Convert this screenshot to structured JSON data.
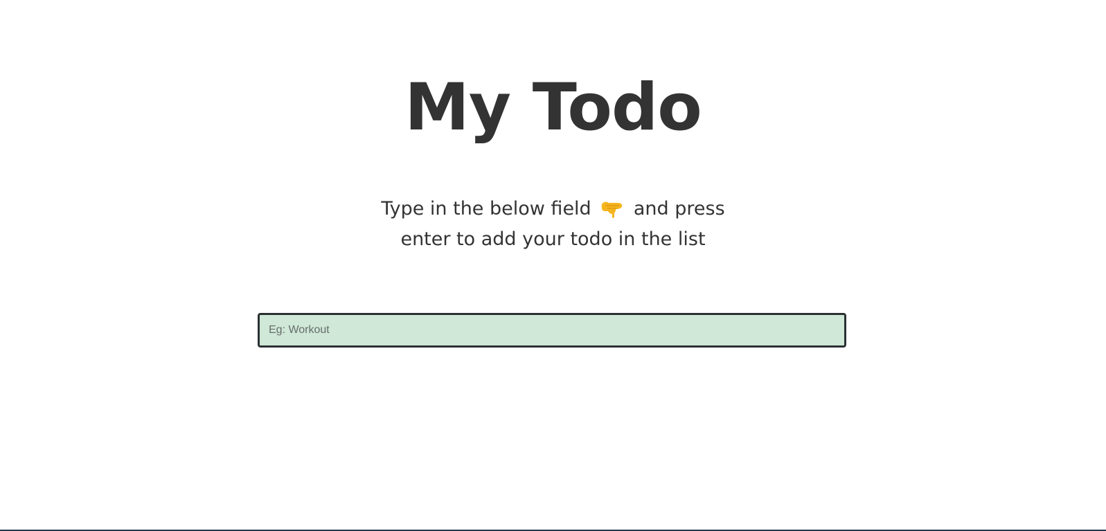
{
  "app": {
    "title": "My Todo"
  },
  "intro": {
    "text_before_icon": "Type in the below field",
    "icon": "backhand-index-pointing-down-icon",
    "text_after_icon": "and press enter to add your todo in the list"
  },
  "todo_input": {
    "value": "",
    "placeholder": "Eg: Workout"
  },
  "colors": {
    "text": "#333333",
    "input_background": "#cfe8d7",
    "input_border": "#2b3033",
    "emoji": "#f6b51e",
    "bottom_bar": "#21394f"
  }
}
